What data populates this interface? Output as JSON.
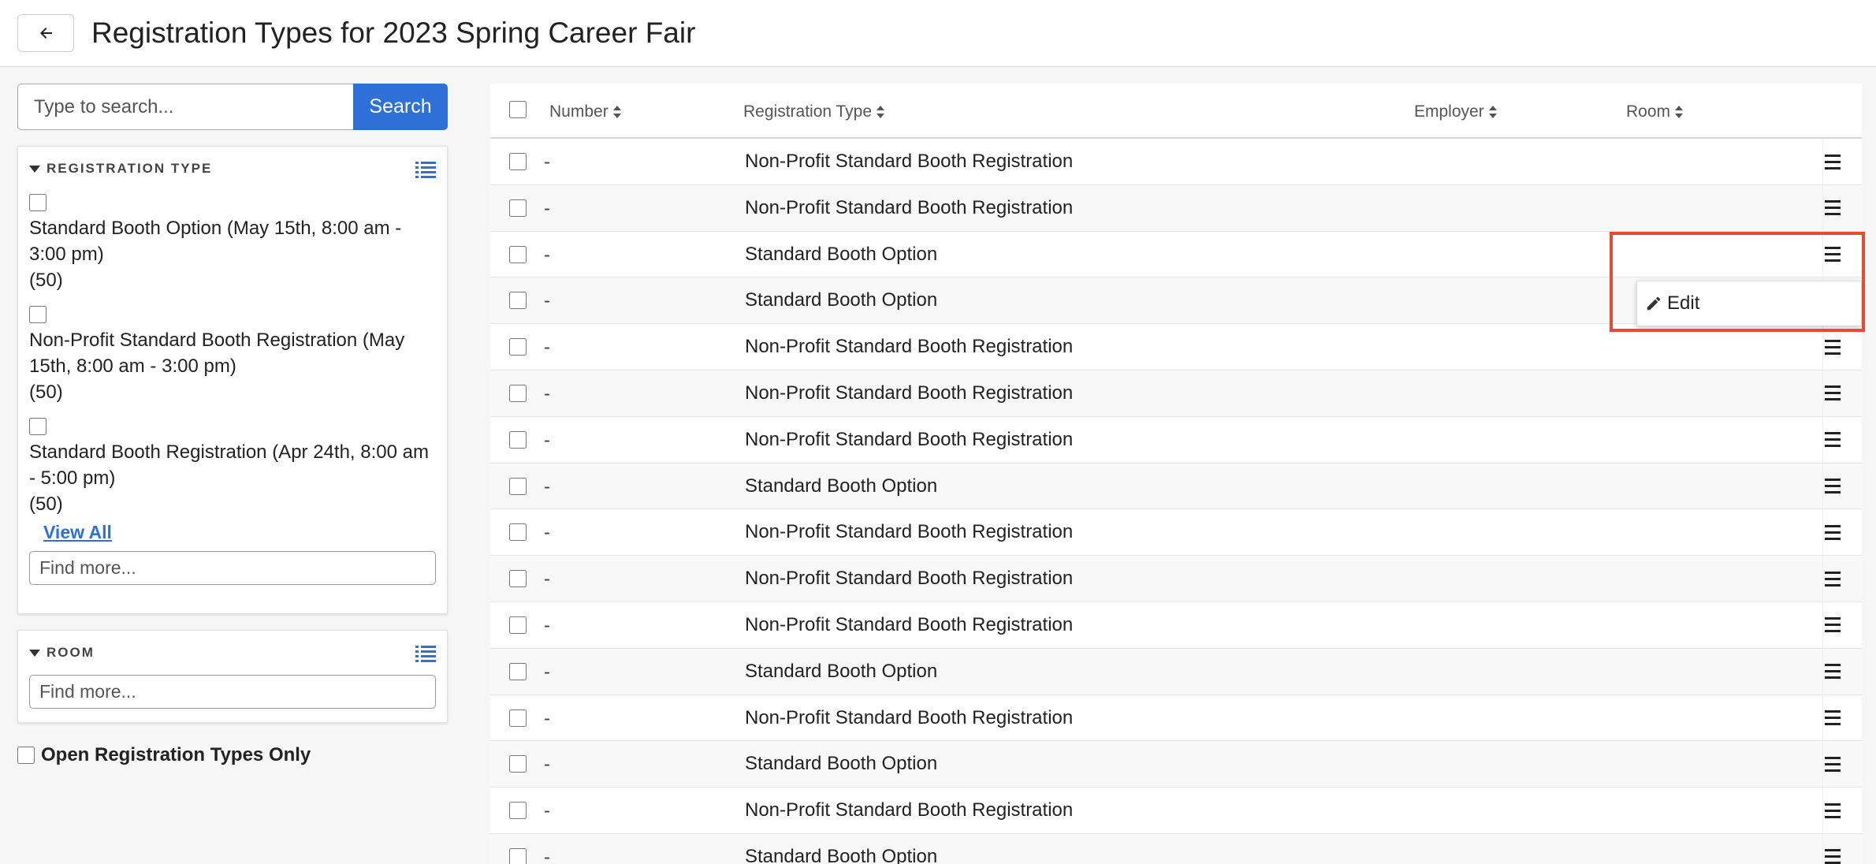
{
  "header": {
    "title": "Registration Types for 2023 Spring Career Fair",
    "back_icon": "arrow-left-icon"
  },
  "search": {
    "placeholder": "Type to search...",
    "button_label": "Search"
  },
  "facets": {
    "registration_type": {
      "title": "REGISTRATION TYPE",
      "items": [
        {
          "label": "Standard Booth Option (May 15th, 8:00 am - 3:00 pm)",
          "count": "(50)"
        },
        {
          "label": "Non-Profit Standard Booth Registration (May 15th, 8:00 am - 3:00 pm)",
          "count": "(50)"
        },
        {
          "label": "Standard Booth Registration (Apr 24th, 8:00 am - 5:00 pm)",
          "count": "(50)"
        }
      ],
      "view_all": "View All",
      "find_placeholder": "Find more..."
    },
    "room": {
      "title": "ROOM",
      "find_placeholder": "Find more..."
    },
    "open_only_label": "Open Registration Types Only"
  },
  "table": {
    "columns": {
      "number": "Number",
      "registration_type": "Registration Type",
      "employer": "Employer",
      "room": "Room"
    },
    "rows": [
      {
        "number": "-",
        "type": "Non-Profit Standard Booth Registration"
      },
      {
        "number": "-",
        "type": "Non-Profit Standard Booth Registration"
      },
      {
        "number": "-",
        "type": "Standard Booth Option"
      },
      {
        "number": "-",
        "type": "Standard Booth Option"
      },
      {
        "number": "-",
        "type": "Non-Profit Standard Booth Registration"
      },
      {
        "number": "-",
        "type": "Non-Profit Standard Booth Registration"
      },
      {
        "number": "-",
        "type": "Non-Profit Standard Booth Registration"
      },
      {
        "number": "-",
        "type": "Standard Booth Option"
      },
      {
        "number": "-",
        "type": "Non-Profit Standard Booth Registration"
      },
      {
        "number": "-",
        "type": "Non-Profit Standard Booth Registration"
      },
      {
        "number": "-",
        "type": "Non-Profit Standard Booth Registration"
      },
      {
        "number": "-",
        "type": "Standard Booth Option"
      },
      {
        "number": "-",
        "type": "Non-Profit Standard Booth Registration"
      },
      {
        "number": "-",
        "type": "Standard Booth Option"
      },
      {
        "number": "-",
        "type": "Non-Profit Standard Booth Registration"
      },
      {
        "number": "-",
        "type": "Standard Booth Option"
      }
    ]
  },
  "row_menu": {
    "edit_label": "Edit",
    "edit_icon": "pencil-icon"
  },
  "colors": {
    "accent": "#2f6fd8",
    "highlight": "#e84a33"
  }
}
